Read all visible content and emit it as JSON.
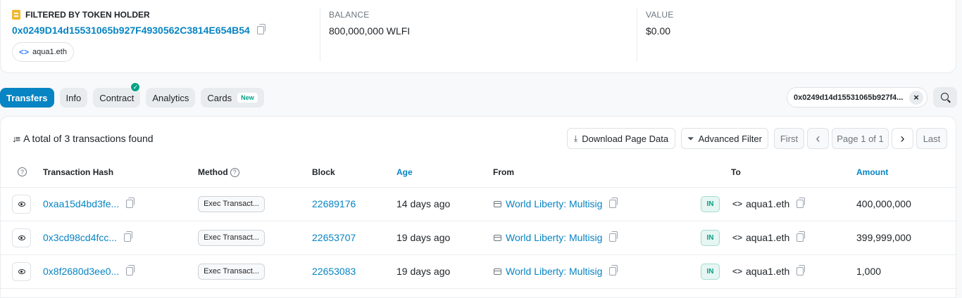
{
  "holder": {
    "title": "FILTERED BY TOKEN HOLDER",
    "address": "0x0249D14d15531065b927F4930562C3814E654B54",
    "ens_name": "aqua1.eth",
    "balance_label": "BALANCE",
    "balance_value": "800,000,000 WLFI",
    "value_label": "VALUE",
    "value_amount": "$0.00"
  },
  "tabs": [
    {
      "label": "Transfers"
    },
    {
      "label": "Info"
    },
    {
      "label": "Contract"
    },
    {
      "label": "Analytics"
    },
    {
      "label": "Cards",
      "badge": "New"
    }
  ],
  "filter_chip": {
    "text": "0x0249d14d15531065b927f4...",
    "close": "×"
  },
  "summary": {
    "text": "A total of 3 transactions found"
  },
  "toolbar": {
    "download_label": "Download Page Data",
    "advanced_filter_label": "Advanced Filter",
    "first_label": "First",
    "prev_label": "‹",
    "page_label": "Page 1 of 1",
    "next_label": "›",
    "last_label": "Last"
  },
  "columns": {
    "txhash": "Transaction Hash",
    "method": "Method",
    "block": "Block",
    "age": "Age",
    "from": "From",
    "to": "To",
    "amount": "Amount"
  },
  "rows": [
    {
      "hash": "0xaa15d4bd3fe...",
      "method": "Exec Transact...",
      "block": "22689176",
      "age": "14 days ago",
      "from": "World Liberty: Multisig",
      "direction": "IN",
      "to": "aqua1.eth",
      "amount": "400,000,000"
    },
    {
      "hash": "0x3cd98cd4fcc...",
      "method": "Exec Transact...",
      "block": "22653707",
      "age": "19 days ago",
      "from": "World Liberty: Multisig",
      "direction": "IN",
      "to": "aqua1.eth",
      "amount": "399,999,000"
    },
    {
      "hash": "0x8f2680d3ee0...",
      "method": "Exec Transact...",
      "block": "22653083",
      "age": "19 days ago",
      "from": "World Liberty: Multisig",
      "direction": "IN",
      "to": "aqua1.eth",
      "amount": "1,000"
    }
  ]
}
